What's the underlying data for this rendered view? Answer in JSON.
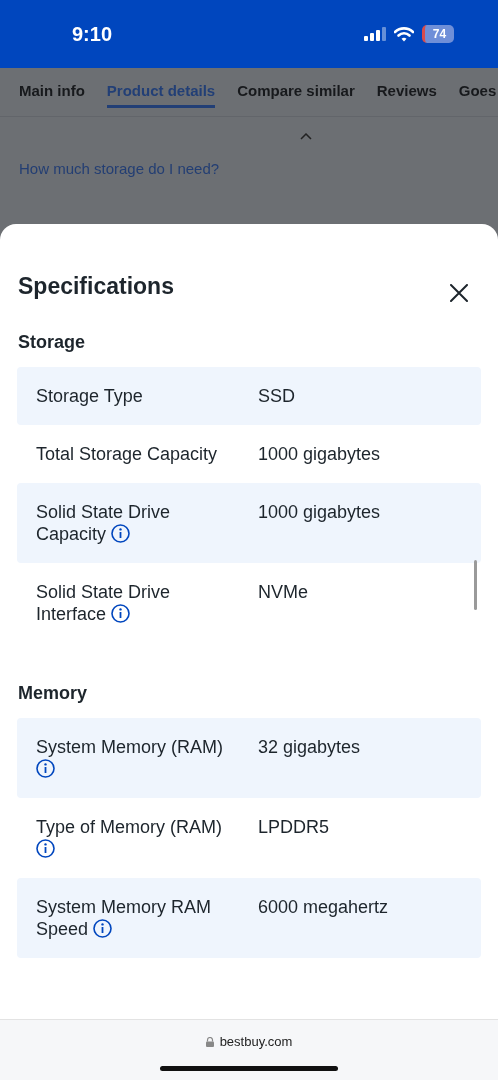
{
  "status_bar": {
    "time": "9:10",
    "battery": "74"
  },
  "tabs": [
    {
      "label": "Main info",
      "selected": false
    },
    {
      "label": "Product details",
      "selected": true
    },
    {
      "label": "Compare similar",
      "selected": false
    },
    {
      "label": "Reviews",
      "selected": false
    },
    {
      "label": "Goes",
      "selected": false
    }
  ],
  "background": {
    "link": "How much storage do I need?"
  },
  "sheet": {
    "title": "Specifications",
    "sections": [
      {
        "title": "Storage",
        "rows": [
          {
            "label": "Storage Type",
            "value": "SSD",
            "info": false
          },
          {
            "label": "Total Storage Capacity",
            "value": "1000 gigabytes",
            "info": false
          },
          {
            "label": "Solid State Drive Capacity",
            "value": "1000 gigabytes",
            "info": true
          },
          {
            "label": "Solid State Drive Interface",
            "value": "NVMe",
            "info": true
          }
        ]
      },
      {
        "title": "Memory",
        "rows": [
          {
            "label": "System Memory (RAM)",
            "value": "32 gigabytes",
            "info": true
          },
          {
            "label": "Type of Memory (RAM)",
            "value": "LPDDR5",
            "info": true
          },
          {
            "label": "System Memory RAM Speed",
            "value": "6000 megahertz",
            "info": true
          }
        ]
      }
    ]
  },
  "browser": {
    "url": "bestbuy.com"
  }
}
